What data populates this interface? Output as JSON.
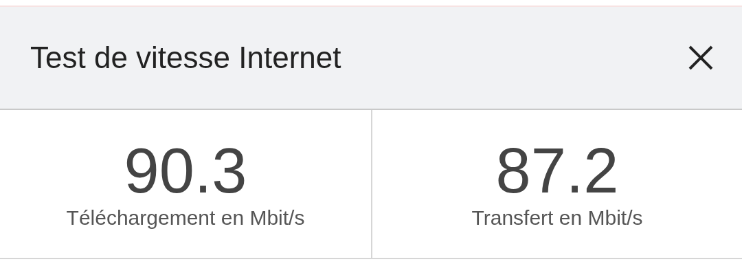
{
  "dialog": {
    "title": "Test de vitesse Internet"
  },
  "results": [
    {
      "value": "90.3",
      "label": "Téléchargement en Mbit/s"
    },
    {
      "value": "87.2",
      "label": "Transfert en Mbit/s"
    }
  ]
}
